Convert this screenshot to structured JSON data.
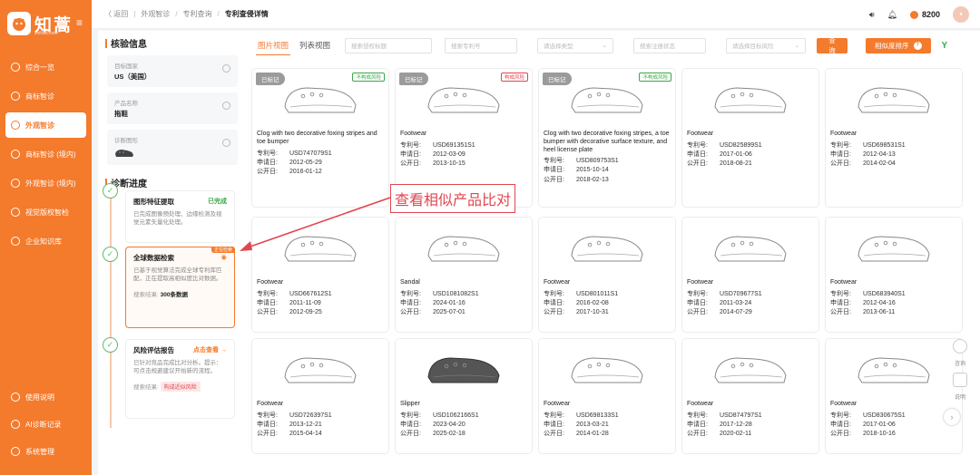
{
  "brand": {
    "name": "知蒿",
    "sub": "zhihao.com"
  },
  "sidebar": {
    "items": [
      {
        "label": "综合一览",
        "icon": "home-icon"
      },
      {
        "label": "商标智诊",
        "icon": "shield-icon"
      },
      {
        "label": "外观智诊",
        "icon": "shield-check-icon",
        "active": true
      },
      {
        "label": "商标智诊 (境内)",
        "icon": "shield-icon"
      },
      {
        "label": "外观智诊 (境内)",
        "icon": "shield-icon"
      },
      {
        "label": "视觉版权智检",
        "icon": "image-icon"
      },
      {
        "label": "企业知识库",
        "icon": "database-icon"
      }
    ],
    "bottom": [
      {
        "label": "使用说明",
        "icon": "help-icon"
      },
      {
        "label": "AI诊断记录",
        "icon": "record-icon"
      },
      {
        "label": "系统管理",
        "icon": "gear-icon"
      }
    ]
  },
  "topbar": {
    "back": "〈 返回",
    "crumbs": [
      "外观智诊",
      "专利查询",
      "专利查侵详情"
    ],
    "points": "8200"
  },
  "left_panel": {
    "title": "核验信息",
    "fields": [
      {
        "label": "目标国家",
        "value": "US（美国）"
      },
      {
        "label": "产品名称",
        "value": "拖鞋"
      },
      {
        "label": "诊断图形",
        "value": ""
      }
    ],
    "progress_title": "诊断进度",
    "steps": [
      {
        "title": "图形特征提取",
        "status": "已完成",
        "desc": "已完成图像预处理、边缘检测及视觉元素矢量化处理。"
      },
      {
        "title": "全球数据检索",
        "status": "",
        "corner": "正在检索",
        "desc": "已基于视觉算法完成全球专利库匹配，正在提取高相似度比对数据。",
        "foot_label": "搜索结果:",
        "foot_value": "300条数据"
      },
      {
        "title": "风险评估报告",
        "status": "点击查看 →",
        "desc": "已针对竞品完成比对分析。提示：可点击规避建议开始新的流程。",
        "foot_label": "搜索结果:",
        "foot_value": "构成近似风险"
      }
    ]
  },
  "filters": {
    "tab_image": "图片视图",
    "tab_list": "列表视图",
    "ph_title": "搜索侵权标题",
    "ph_patent": "搜索专利号",
    "ph_type": "请选择类型",
    "ph_status": "搜索注册状态",
    "ph_risk": "请选择目标风险",
    "query_btn": "查 询",
    "sort_btn": "相似度排序"
  },
  "cards": [
    {
      "title": "Clog with two decorative foxing stripes and toe bumper",
      "patent": "USD747079S1",
      "apply": "2012-05-29",
      "publish": "2016-01-12",
      "marked": "已标记",
      "risk": "不构成风险",
      "risk_type": "no"
    },
    {
      "title": "Footwear",
      "patent": "USD691351S1",
      "apply": "2012-03-09",
      "publish": "2013-10-15",
      "marked": "已标记",
      "risk": "构成风险",
      "risk_type": "yes"
    },
    {
      "title": "Clog with two decorative foxing stripes, a toe bumper with decorative surface texture, and heel license plate",
      "patent": "USD809753S1",
      "apply": "2015-10-14",
      "publish": "2018-02-13",
      "marked": "已标记",
      "risk": "不构成风险",
      "risk_type": "no"
    },
    {
      "title": "Footwear",
      "patent": "USD825899S1",
      "apply": "2017-01-06",
      "publish": "2018-08-21"
    },
    {
      "title": "Footwear",
      "patent": "USD698531S1",
      "apply": "2012-04-13",
      "publish": "2014-02-04"
    },
    {
      "title": "Footwear",
      "patent": "USD667612S1",
      "apply": "2011-11-09",
      "publish": "2012-09-25"
    },
    {
      "title": "Sandal",
      "patent": "USD1081082S1",
      "apply": "2024-01-16",
      "publish": "2025-07-01"
    },
    {
      "title": "Footwear",
      "patent": "USD801011S1",
      "apply": "2016-02-08",
      "publish": "2017-10-31"
    },
    {
      "title": "Footwear",
      "patent": "USD709677S1",
      "apply": "2011-03-24",
      "publish": "2014-07-29"
    },
    {
      "title": "Footwear",
      "patent": "USD683940S1",
      "apply": "2012-04-16",
      "publish": "2013-06-11"
    },
    {
      "title": "Footwear",
      "patent": "USD726397S1",
      "apply": "2013-12-21",
      "publish": "2015-04-14"
    },
    {
      "title": "Slipper",
      "patent": "USD1062166S1",
      "apply": "2023-04-20",
      "publish": "2025-02-18"
    },
    {
      "title": "Footwear",
      "patent": "USD698133S1",
      "apply": "2013-03-21",
      "publish": "2014-01-28"
    },
    {
      "title": "Footwear",
      "patent": "USD874797S1",
      "apply": "2017-12-28",
      "publish": "2020-02-11"
    },
    {
      "title": "Footwear",
      "patent": "USD830675S1",
      "apply": "2017-01-06",
      "publish": "2018-10-16"
    }
  ],
  "labels": {
    "patent": "专利号:",
    "apply": "申请日:",
    "publish": "公开日:"
  },
  "annotation": "查看相似产品比对",
  "side_help": {
    "consult": "咨询",
    "manual": "说明"
  },
  "colors": {
    "accent": "#f47a2c",
    "success": "#3aa74a",
    "danger": "#e0464f"
  }
}
